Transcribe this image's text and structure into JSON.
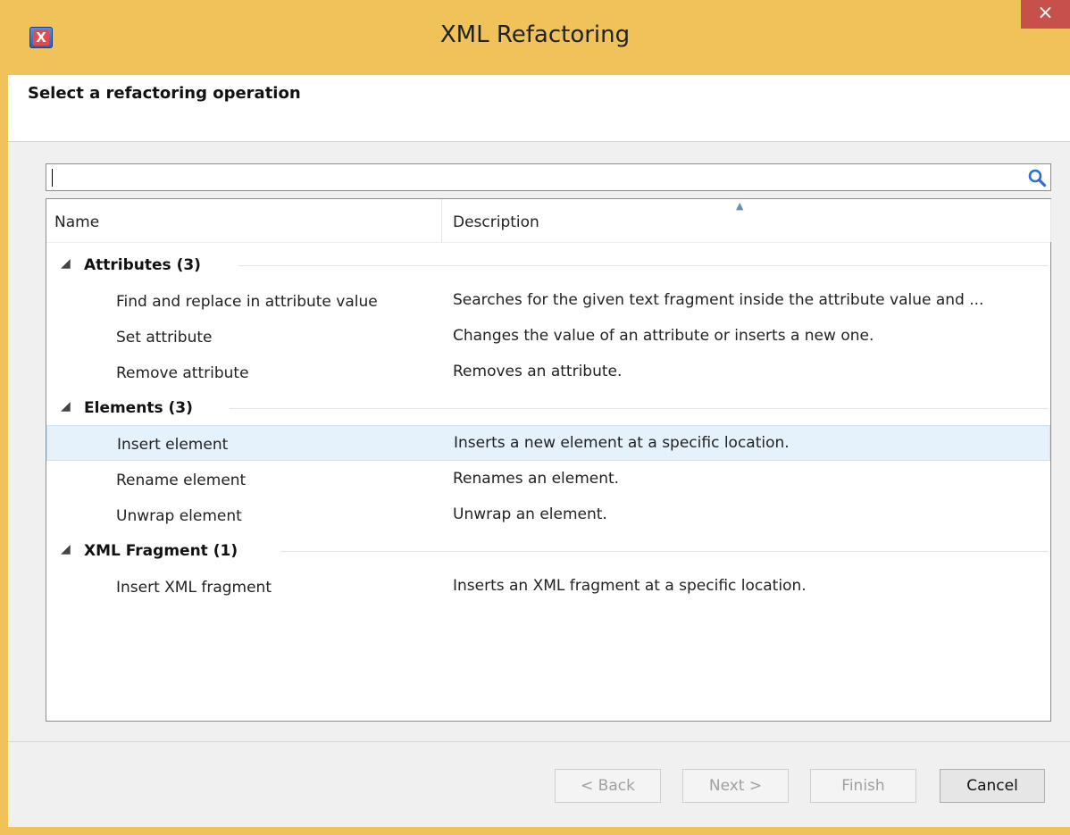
{
  "window": {
    "title": "XML Refactoring",
    "close_symbol": "×",
    "app_icon_letter": "X"
  },
  "header": {
    "title": "Select a refactoring operation"
  },
  "search": {
    "value": "",
    "icon": "search-icon"
  },
  "table": {
    "columns": [
      "Name",
      "Description"
    ],
    "sort_indicator": "▲",
    "groups": [
      {
        "label": "Attributes (3)",
        "expander": "◢",
        "rows": [
          {
            "name": "Find and replace in attribute value",
            "description": "Searches for the given text fragment inside the attribute value and ..."
          },
          {
            "name": "Set attribute",
            "description": "Changes the value of an attribute or inserts a new one."
          },
          {
            "name": "Remove attribute",
            "description": "Removes an attribute."
          }
        ]
      },
      {
        "label": "Elements (3)",
        "expander": "◢",
        "rows": [
          {
            "name": "Insert element",
            "description": "Inserts a new element at a specific location."
          },
          {
            "name": "Rename element",
            "description": "Renames an element."
          },
          {
            "name": "Unwrap element",
            "description": "Unwrap an element."
          }
        ]
      },
      {
        "label": "XML Fragment (1)",
        "expander": "◢",
        "rows": [
          {
            "name": "Insert XML fragment",
            "description": "Inserts an XML fragment at a specific location."
          }
        ]
      }
    ]
  },
  "buttons": {
    "back": "< Back",
    "next": "Next >",
    "finish": "Finish",
    "cancel": "Cancel"
  },
  "colors": {
    "titlebar": "#efc35a",
    "close": "#c7504a",
    "selection": "#e5f1fb"
  }
}
